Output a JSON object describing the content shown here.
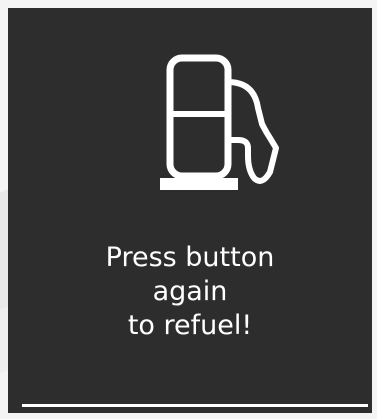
{
  "icon": "fuel-pump-icon",
  "message": {
    "line1": "Press button",
    "line2": "again",
    "line3": "to refuel!"
  },
  "colors": {
    "panel_background": "#2d2d2d",
    "foreground": "#ffffff"
  }
}
